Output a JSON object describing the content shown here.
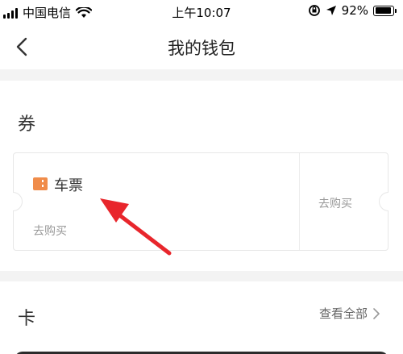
{
  "status_bar": {
    "carrier": "中国电信",
    "time": "上午10:07",
    "battery_percent": "92%",
    "battery_level": 0.92,
    "icons": [
      "signal-icon",
      "wifi-icon",
      "rotation-lock-icon",
      "location-arrow-icon",
      "battery-icon"
    ]
  },
  "nav": {
    "title": "我的钱包",
    "back_icon": "chevron-left-icon"
  },
  "coupons": {
    "title": "券",
    "card": {
      "icon": "ticket-icon",
      "icon_color": "#f08c4a",
      "name": "车票",
      "buy_left": "去购买",
      "buy_right": "去购买"
    }
  },
  "cards": {
    "title": "卡",
    "view_all": "查看全部",
    "view_all_icon": "chevron-right-icon"
  },
  "annotation": {
    "type": "red-arrow",
    "color": "#e8262c",
    "points_to": "车票"
  }
}
